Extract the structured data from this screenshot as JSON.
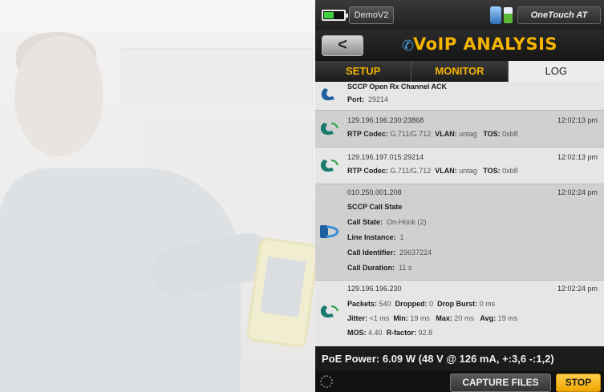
{
  "status_bar": {
    "profile": "DemoV2",
    "brand": "OneTouch AT",
    "battery_color": "#3fd13f",
    "icons": [
      "battery-icon",
      "network-icon",
      "sd-card-icon"
    ]
  },
  "header": {
    "back_label": "<",
    "title": "VoIP ANALYSIS",
    "title_color": "#f5b400"
  },
  "tabs": [
    {
      "label": "SETUP",
      "active": false
    },
    {
      "label": "MONITOR",
      "active": false
    },
    {
      "label": "LOG",
      "active": true
    }
  ],
  "log_entries": [
    {
      "icon": "handset-icon",
      "title": "SCCP Open Rx Channel ACK",
      "port_label": "Port:",
      "port_value": "29214"
    },
    {
      "icon": "rtp-phone-icon",
      "address": "129.196.196.230:23868",
      "time": "12:02:13 pm",
      "codec_label": "RTP Codec:",
      "codec_value": "G.711/G.712",
      "vlan_label": "VLAN:",
      "vlan_value": "untag",
      "tos_label": "TOS:",
      "tos_value": "0xb8"
    },
    {
      "icon": "rtp-phone-icon",
      "address": "129.196.197.015:29214",
      "time": "12:02:13 pm",
      "codec_label": "RTP Codec:",
      "codec_value": "G.711/G.712",
      "vlan_label": "VLAN:",
      "vlan_value": "untag",
      "tos_label": "TOS:",
      "tos_value": "0xb8"
    },
    {
      "icon": "call-state-icon",
      "address": "010.250.001.208",
      "time": "12:02:24 pm",
      "title": "SCCP Call State",
      "call_state_label": "Call State:",
      "call_state_value": "On-Hook (2)",
      "line_instance_label": "Line Instance:",
      "line_instance_value": "1",
      "call_id_label": "Call Identifier:",
      "call_id_value": "29637224",
      "call_duration_label": "Call Duration:",
      "call_duration_value": "11 s"
    },
    {
      "icon": "rtp-phone-icon",
      "address": "129.196.196.230",
      "time": "12:02:24 pm",
      "packets_label": "Packets:",
      "packets_value": "540",
      "dropped_label": "Dropped:",
      "dropped_value": "0",
      "drop_burst_label": "Drop Burst:",
      "drop_burst_value": "0 ms",
      "jitter_label": "Jitter:",
      "jitter_value": "<1 ms",
      "min_label": "Min:",
      "min_value": "19 ms",
      "max_label": "Max:",
      "max_value": "20 ms",
      "avg_label": "Avg:",
      "avg_value": "19 ms",
      "mos_label": "MOS:",
      "mos_value": "4.40",
      "rfactor_label": "R-factor:",
      "rfactor_value": "92.8"
    }
  ],
  "power": "PoE Power: 6.09 W (48 V @ 126 mA, +:3,6 -:1,2)",
  "buttons": {
    "capture": "CAPTURE FILES",
    "stop": "STOP"
  }
}
